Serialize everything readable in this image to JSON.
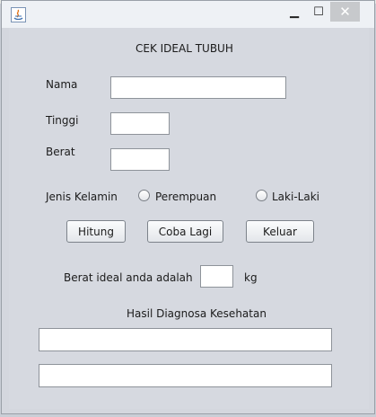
{
  "window": {
    "minimize_glyph": "▁",
    "maximize_glyph": "☐",
    "close_glyph": "✕"
  },
  "form": {
    "title": "CEK IDEAL TUBUH",
    "nama_label": "Nama",
    "nama_value": "",
    "tinggi_label": "Tinggi",
    "tinggi_value": "",
    "berat_label": "Berat",
    "berat_value": "",
    "gender_label": "Jenis Kelamin",
    "gender_options": [
      "Perempuan",
      "Laki-Laki"
    ],
    "buttons": {
      "hitung": "Hitung",
      "coba_lagi": "Coba Lagi",
      "keluar": "Keluar"
    },
    "result_label": "Berat ideal anda adalah",
    "result_value": "",
    "result_unit": "kg",
    "diagnosa_label": "Hasil Diagnosa Kesehatan",
    "diagnosa_1": "",
    "diagnosa_2": ""
  },
  "colors": {
    "accent": "#d4d7de",
    "close_button": "#c7c9cc"
  }
}
